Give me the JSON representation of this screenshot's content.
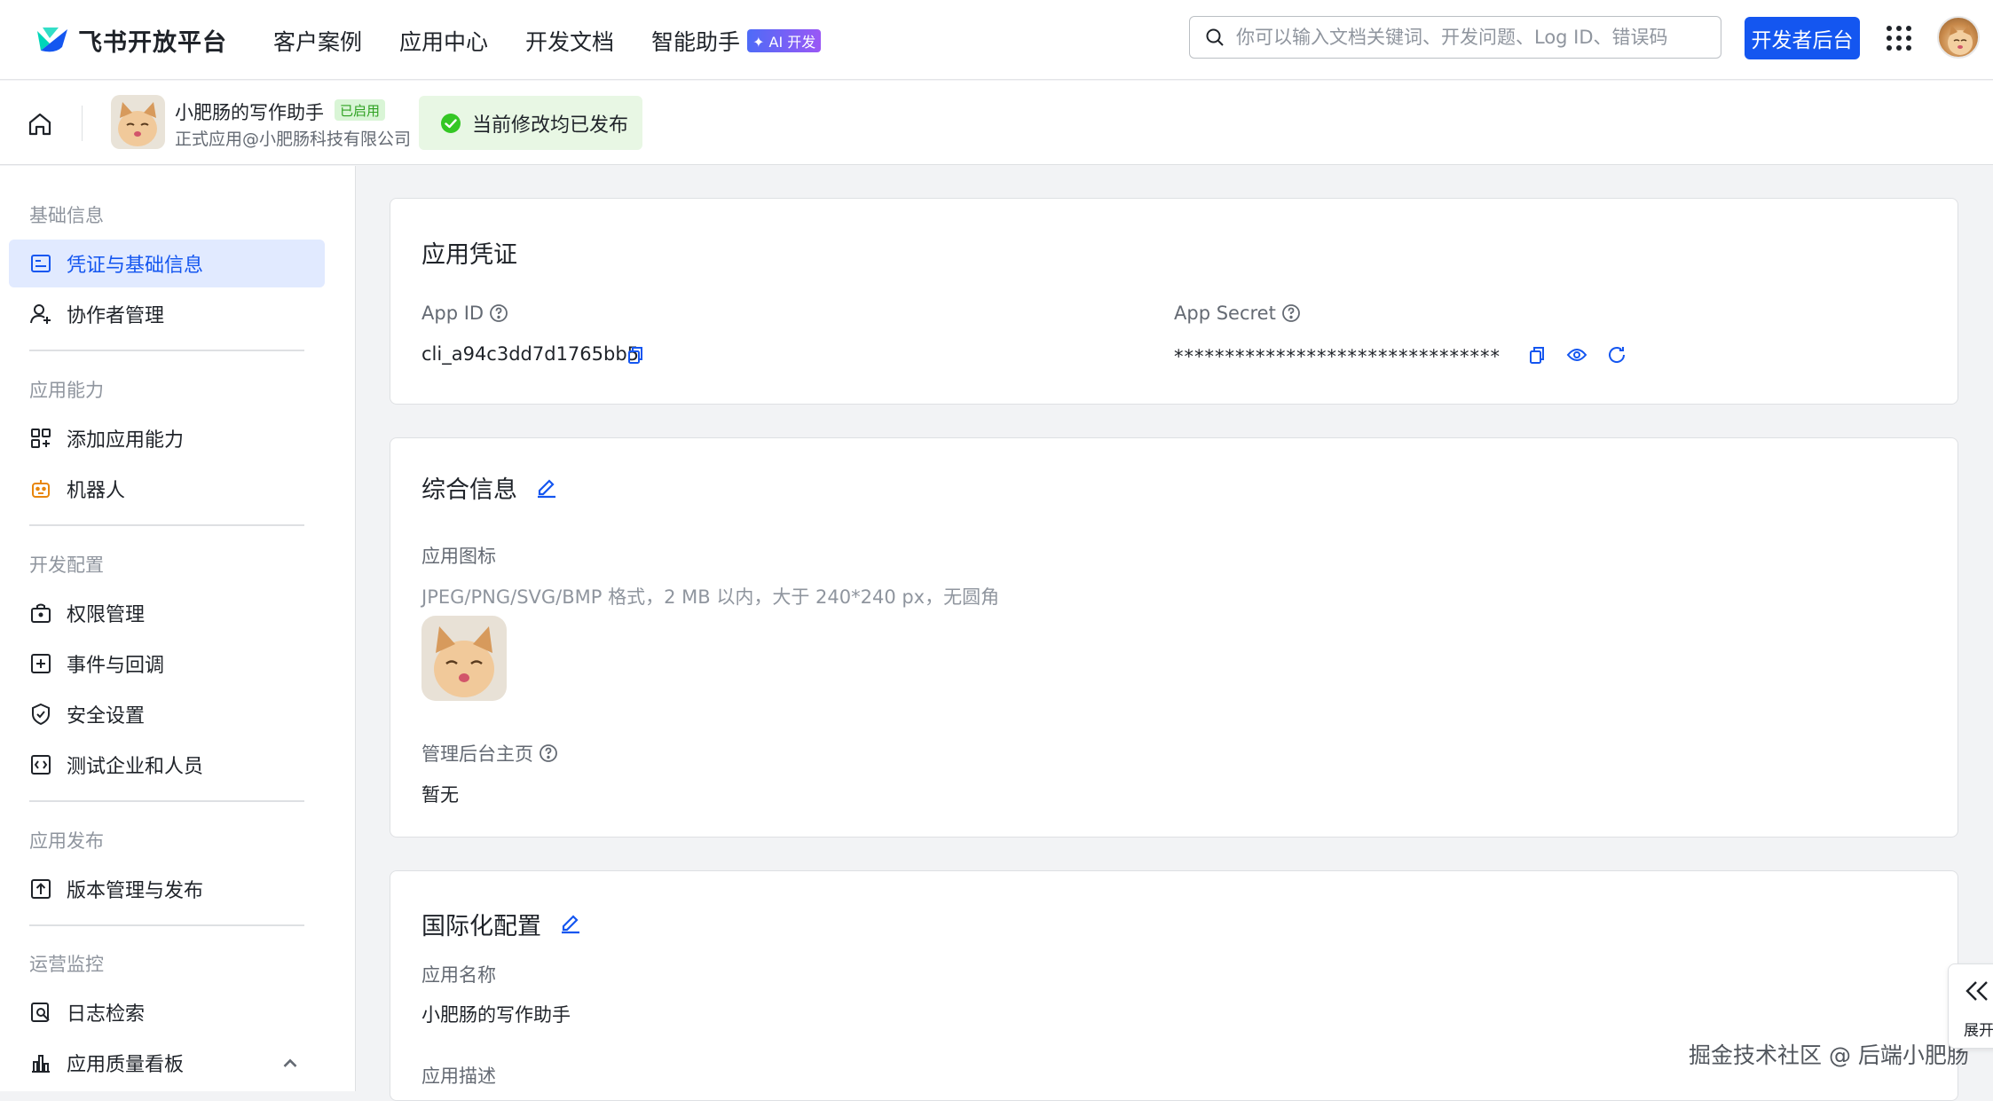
{
  "brand": {
    "name": "飞书开放平台"
  },
  "nav": {
    "links": [
      "客户案例",
      "应用中心",
      "开发文档",
      "智能助手"
    ],
    "ai_badge": "✦ AI 开发",
    "search_placeholder": "你可以输入文档关键词、开发问题、Log ID、错误码",
    "dev_console": "开发者后台"
  },
  "app": {
    "name": "小肥肠的写作助手",
    "status_badge": "已启用",
    "subtitle": "正式应用@小肥肠科技有限公司",
    "publish_status": "当前修改均已发布"
  },
  "sidebar": {
    "groups": [
      "基础信息",
      "应用能力",
      "开发配置",
      "应用发布",
      "运营监控"
    ],
    "items": [
      {
        "label": "凭证与基础信息",
        "icon": "id-card-icon",
        "active": true
      },
      {
        "label": "协作者管理",
        "icon": "user-add-icon"
      },
      {
        "label": "添加应用能力",
        "icon": "apps-icon"
      },
      {
        "label": "机器人",
        "icon": "robot-icon"
      },
      {
        "label": "权限管理",
        "icon": "lock-icon"
      },
      {
        "label": "事件与回调",
        "icon": "plus-square-icon"
      },
      {
        "label": "安全设置",
        "icon": "shield-icon"
      },
      {
        "label": "测试企业和人员",
        "icon": "code-icon"
      },
      {
        "label": "版本管理与发布",
        "icon": "upload-icon"
      },
      {
        "label": "日志检索",
        "icon": "log-search-icon"
      },
      {
        "label": "应用质量看板",
        "icon": "bar-chart-icon"
      }
    ]
  },
  "credentials": {
    "title": "应用凭证",
    "app_id_label": "App ID",
    "app_id_value": "cli_a94c3dd7d1765bb5",
    "app_secret_label": "App Secret",
    "app_secret_value": "********************************"
  },
  "general": {
    "title": "综合信息",
    "icon_label": "应用图标",
    "icon_hint": "JPEG/PNG/SVG/BMP 格式，2 MB 以内，大于 240*240 px，无圆角",
    "homepage_label": "管理后台主页",
    "homepage_value": "暂无"
  },
  "i18n": {
    "title": "国际化配置",
    "name_label": "应用名称",
    "name_value": "小肥肠的写作助手",
    "desc_label": "应用描述"
  },
  "expand_tab": {
    "label": "展开"
  },
  "watermark": "掘金技术社区 @ 后端小肥肠",
  "colors": {
    "primary": "#1456f0",
    "success": "#34c724",
    "active_bg": "#e1eaff"
  }
}
